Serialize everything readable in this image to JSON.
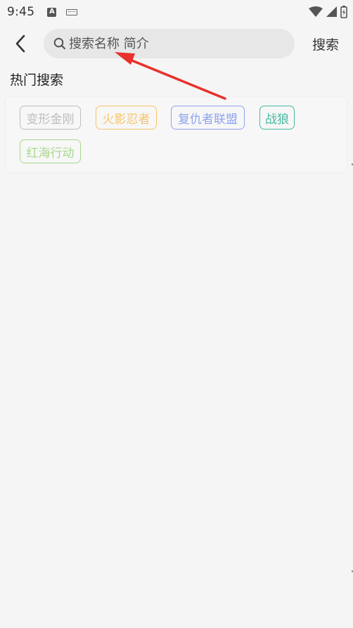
{
  "status_bar": {
    "time": "9:45",
    "icons": [
      "a-notification-icon",
      "keyboard-icon",
      "wifi-icon",
      "cellular-signal-icon",
      "battery-icon"
    ]
  },
  "header": {
    "back_icon": "chevron-left-icon",
    "search_icon": "magnifier-icon",
    "search_placeholder": "搜索名称 简介",
    "search_value": "",
    "search_button_label": "搜索"
  },
  "hot_search": {
    "title": "热门搜索",
    "tags": [
      {
        "label": "变形金刚",
        "color": "#bdbdbd"
      },
      {
        "label": "火影忍者",
        "color": "#f7c46c"
      },
      {
        "label": "复仇者联盟",
        "color": "#8ea3ec"
      },
      {
        "label": "战狼",
        "color": "#48b7a0"
      },
      {
        "label": "红海行动",
        "color": "#a8d88d"
      }
    ]
  },
  "annotation": {
    "arrow_color": "#e8322d"
  }
}
